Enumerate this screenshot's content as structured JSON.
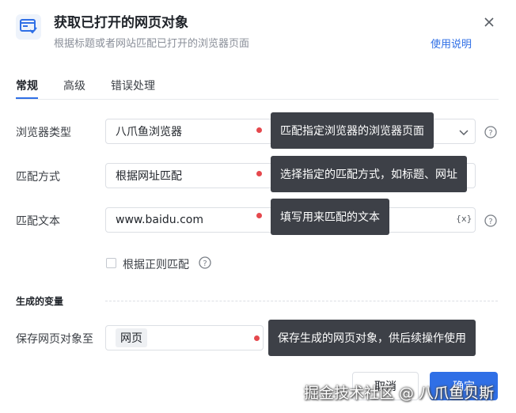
{
  "header": {
    "title": "获取已打开的网页对象",
    "subtitle": "根据标题或者网站匹配已打开的浏览器页面",
    "help_link": "使用说明"
  },
  "tabs": [
    {
      "label": "常规"
    },
    {
      "label": "高级"
    },
    {
      "label": "错误处理"
    }
  ],
  "form": {
    "browser_type": {
      "label": "浏览器类型",
      "value": "八爪鱼浏览器",
      "tooltip": "匹配指定浏览器的浏览器页面"
    },
    "match_mode": {
      "label": "匹配方式",
      "value": "根据网址匹配",
      "tooltip": "选择指定的匹配方式，如标题、网址"
    },
    "match_text": {
      "label": "匹配文本",
      "value": "www.baidu.com",
      "tooltip": "填写用来匹配的文本",
      "var_btn": "{x}"
    },
    "regex_checkbox": {
      "label": "根据正则匹配",
      "checked": false
    }
  },
  "output": {
    "section_title": "生成的变量",
    "save_label": "保存网页对象至",
    "var_value": "网页",
    "tooltip": "保存生成的网页对象，供后续操作使用"
  },
  "footer": {
    "cancel": "取消",
    "ok": "确定"
  },
  "watermark": "掘金技术社区 @ 八爪鱼贝斯",
  "colors": {
    "accent": "#2f6fe6",
    "tooltip_bg": "#3d4047",
    "marker": "#e5484d"
  }
}
